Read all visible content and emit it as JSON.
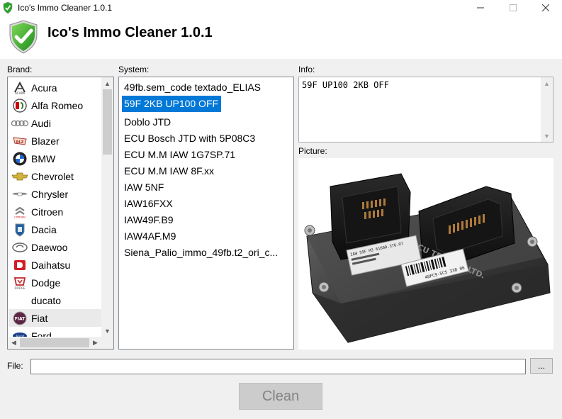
{
  "window": {
    "title": "Ico's Immo Cleaner 1.0.1",
    "minimize_glyph": "—",
    "maximize_glyph": "☐",
    "close_glyph": "✕"
  },
  "header": {
    "title": "Ico's Immo Cleaner 1.0.1",
    "icon": "shield-check-icon"
  },
  "brand": {
    "label": "Brand:",
    "items": [
      {
        "label": "Acura",
        "icon": "acura-logo"
      },
      {
        "label": "Alfa Romeo",
        "icon": "alfa-romeo-logo"
      },
      {
        "label": "Audi",
        "icon": "audi-logo"
      },
      {
        "label": "Blazer",
        "icon": "blazer-logo"
      },
      {
        "label": "BMW",
        "icon": "bmw-logo"
      },
      {
        "label": "Chevrolet",
        "icon": "chevrolet-logo"
      },
      {
        "label": "Chrysler",
        "icon": "chrysler-logo"
      },
      {
        "label": "Citroen",
        "icon": "citroen-logo"
      },
      {
        "label": "Dacia",
        "icon": "dacia-logo"
      },
      {
        "label": "Daewoo",
        "icon": "daewoo-logo"
      },
      {
        "label": "Daihatsu",
        "icon": "daihatsu-logo"
      },
      {
        "label": "Dodge",
        "icon": "dodge-logo"
      },
      {
        "label": "ducato",
        "icon": ""
      },
      {
        "label": "Fiat",
        "icon": "fiat-logo"
      },
      {
        "label": "Ford",
        "icon": "ford-logo"
      }
    ],
    "selected": "Fiat"
  },
  "system": {
    "label": "System:",
    "items": [
      "49fb.sem_code textado_ELIAS",
      "59F 2KB UP100 OFF",
      "Doblo JTD",
      "ECU Bosch JTD with 5P08C3",
      "ECU M.M IAW 1G7SP.71",
      "ECU M.M IAW 8F.xx",
      "IAW 5NF",
      "IAW16FXX",
      "IAW49F.B9",
      "IAW4AF.M9",
      "Siena_Palio_immo_49fb.t2_ori_c..."
    ],
    "selected": "59F 2KB UP100 OFF"
  },
  "info": {
    "label": "Info:",
    "text": "59F UP100 2KB OFF"
  },
  "picture": {
    "label": "Picture:",
    "ecu_text": "ECU TESTING LTD.",
    "sticker_text": "IAW 59F M3  61600.376.07",
    "part_number": "48FC9-5C5   338 06"
  },
  "file": {
    "label": "File:",
    "value": "",
    "browse_label": "..."
  },
  "clean_button": {
    "label": "Clean",
    "enabled": false
  },
  "colors": {
    "selection": "#0078d7",
    "shield_green": "#2aa52a",
    "disabled_text": "#838383"
  }
}
